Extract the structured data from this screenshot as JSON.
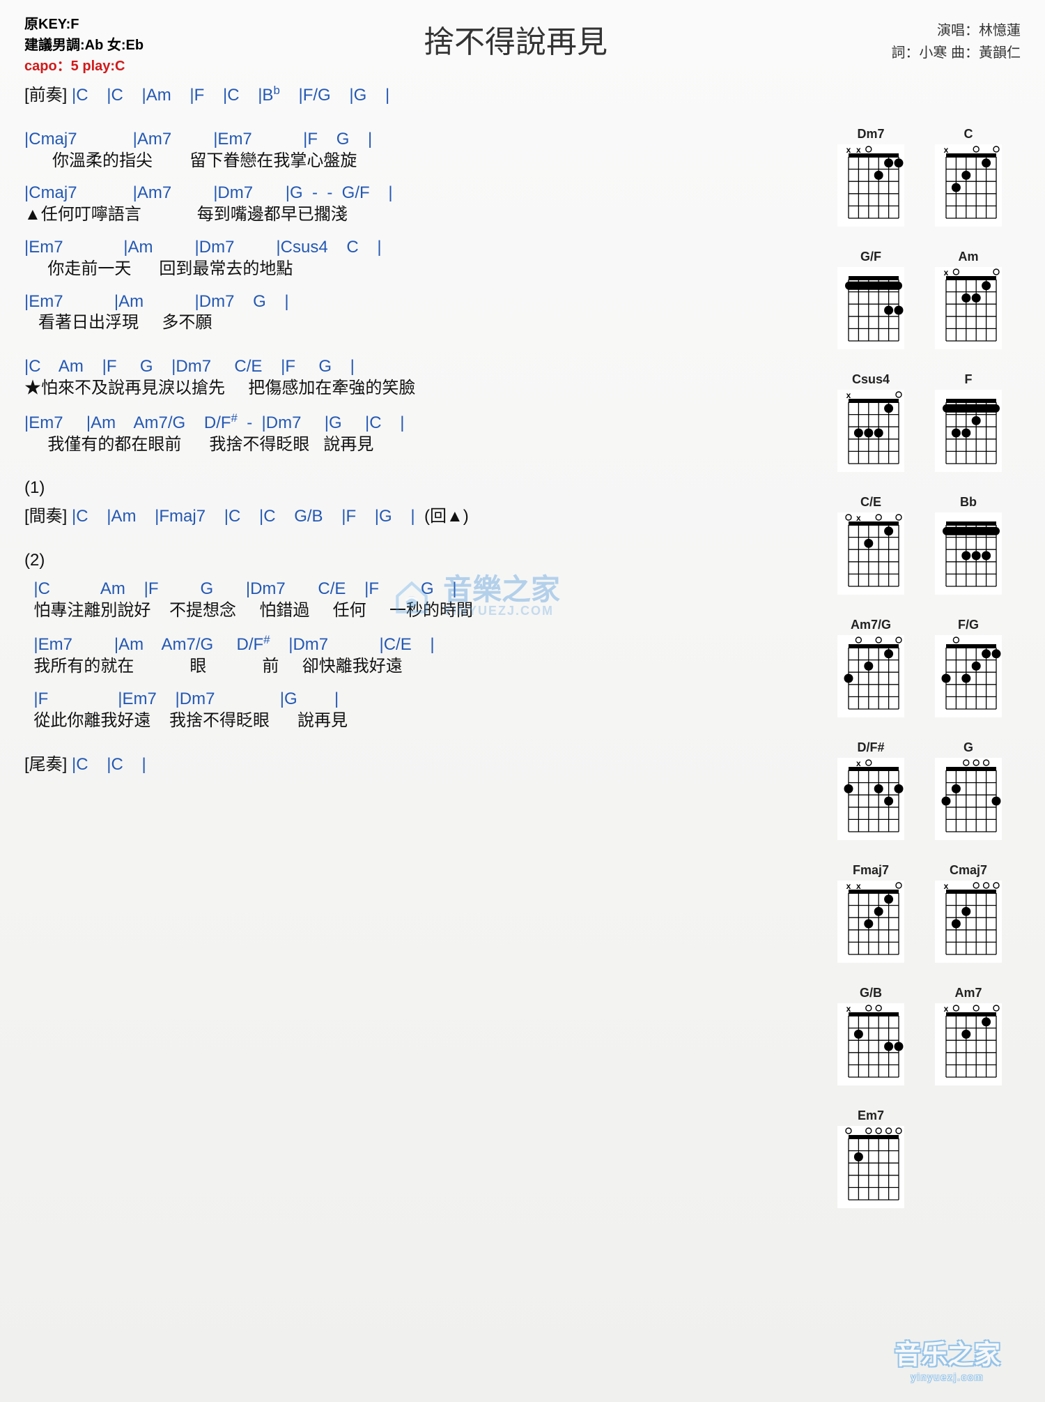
{
  "header": {
    "title": "捨不得說再見",
    "original_key": "原KEY:F",
    "suggest_key": "建議男調:Ab 女:Eb",
    "capo": "capo：5 play:C",
    "credit_top": "演唱：林憶蓮",
    "credit_bottom": "詞：小寒  曲：黃韻仁"
  },
  "sections": {
    "intro_label": "[前奏]",
    "intro_chords": " |C    |C    |Am    |F    |C    |B",
    "intro_chords2": "    |F/G    |G    |",
    "interlude_label": "[間奏]",
    "outro_label": "[尾奏]",
    "num1": "(1)",
    "num2": "(2)",
    "repeat": "(回▲)"
  },
  "verse1": {
    "c1": "|Cmaj7            |Am7         |Em7           |F    G    |",
    "l1": "      你溫柔的指尖        留下眷戀在我掌心盤旋",
    "c2": "|Cmaj7            |Am7         |Dm7       |G  -  -  G/F    |",
    "l2": "▲任何叮嚀語言            每到嘴邊都早已擱淺",
    "c3": "|Em7             |Am         |Dm7         |Csus4    C    |",
    "l3": "     你走前一天      回到最常去的地點",
    "c4": "|Em7           |Am           |Dm7    G    |",
    "l4": "   看著日出浮現     多不願"
  },
  "chorus": {
    "c1": "|C    Am    |F     G    |Dm7     C/E    |F     G    |",
    "l1": "★怕來不及說再見淚以搶先     把傷感加在牽強的笑臉",
    "c2": "|Em7     |Am    Am7/G    D/F",
    "c2b": "  -  |Dm7     |G     |C    |",
    "l2": "     我僅有的都在眼前      我捨不得眨眼   說再見"
  },
  "interlude": {
    "c": " |C    |Am    |Fmaj7    |C    |C    G/B    |F    |G    |  "
  },
  "verse2": {
    "c1": "  |C           Am    |F         G       |Dm7       C/E    |F         G    |",
    "l1": "  怕專注離別說好    不提想念     怕錯過     任何     一秒的時間",
    "c2": "  |Em7         |Am    Am7/G     D/F",
    "c2b": "    |Dm7           |C/E    |",
    "l2": "  我所有的就在            眼            前     卻快離我好遠",
    "c3": "  |F               |Em7    |Dm7              |G        |",
    "l3": "  從此你離我好遠    我捨不得眨眼      說再見"
  },
  "outro": {
    "c": " |C    |C    |"
  },
  "diagrams": {
    "rows": [
      [
        {
          "name": "Dm7",
          "nut": true,
          "barre": null,
          "dots": [
            [
              1,
              1
            ],
            [
              2,
              1
            ],
            [
              3,
              2
            ]
          ],
          "open": [
            4
          ],
          "mute": [
            5,
            6
          ]
        },
        {
          "name": "C",
          "nut": true,
          "barre": null,
          "dots": [
            [
              2,
              1
            ],
            [
              4,
              2
            ],
            [
              5,
              3
            ]
          ],
          "open": [
            1,
            3
          ],
          "mute": [
            6
          ]
        }
      ],
      [
        {
          "name": "G/F",
          "nut": true,
          "barre": [
            1,
            1,
            6
          ],
          "dots": [
            [
              1,
              3
            ],
            [
              2,
              3
            ]
          ],
          "open": [],
          "mute": []
        },
        {
          "name": "Am",
          "nut": true,
          "barre": null,
          "dots": [
            [
              2,
              1
            ],
            [
              3,
              2
            ],
            [
              4,
              2
            ]
          ],
          "open": [
            1,
            5
          ],
          "mute": [
            6
          ]
        }
      ],
      [
        {
          "name": "Csus4",
          "nut": true,
          "barre": null,
          "dots": [
            [
              2,
              1
            ],
            [
              4,
              3
            ],
            [
              5,
              3
            ],
            [
              3,
              3
            ]
          ],
          "open": [
            1
          ],
          "mute": [
            6
          ]
        },
        {
          "name": "F",
          "nut": true,
          "barre": [
            1,
            1,
            6
          ],
          "dots": [
            [
              3,
              2
            ],
            [
              4,
              3
            ],
            [
              5,
              3
            ]
          ],
          "open": [],
          "mute": []
        }
      ],
      [
        {
          "name": "C/E",
          "nut": true,
          "barre": null,
          "dots": [
            [
              2,
              1
            ],
            [
              4,
              2
            ]
          ],
          "open": [
            1,
            3,
            6
          ],
          "mute": [
            5
          ]
        },
        {
          "name": "Bb",
          "nut": true,
          "barre": [
            1,
            1,
            6
          ],
          "dots": [
            [
              2,
              3
            ],
            [
              3,
              3
            ],
            [
              4,
              3
            ]
          ],
          "open": [],
          "mute": []
        }
      ],
      [
        {
          "name": "Am7/G",
          "nut": true,
          "barre": null,
          "dots": [
            [
              2,
              1
            ],
            [
              4,
              2
            ],
            [
              6,
              3
            ]
          ],
          "open": [
            1,
            3,
            5
          ],
          "mute": []
        },
        {
          "name": "F/G",
          "nut": true,
          "barre": null,
          "dots": [
            [
              1,
              1
            ],
            [
              2,
              1
            ],
            [
              3,
              2
            ],
            [
              4,
              3
            ],
            [
              6,
              3
            ]
          ],
          "open": [
            5
          ],
          "mute": []
        }
      ],
      [
        {
          "name": "D/F#",
          "nut": true,
          "barre": null,
          "dots": [
            [
              1,
              2
            ],
            [
              3,
              2
            ],
            [
              6,
              2
            ],
            [
              2,
              3
            ]
          ],
          "open": [
            4
          ],
          "mute": [
            5
          ]
        },
        {
          "name": "G",
          "nut": true,
          "barre": null,
          "dots": [
            [
              5,
              2
            ],
            [
              6,
              3
            ],
            [
              1,
              3
            ]
          ],
          "open": [
            2,
            3,
            4
          ],
          "mute": []
        }
      ],
      [
        {
          "name": "Fmaj7",
          "nut": true,
          "barre": null,
          "dots": [
            [
              2,
              1
            ],
            [
              3,
              2
            ],
            [
              4,
              3
            ]
          ],
          "open": [
            1
          ],
          "mute": [
            5,
            6
          ]
        },
        {
          "name": "Cmaj7",
          "nut": true,
          "barre": null,
          "dots": [
            [
              4,
              2
            ],
            [
              5,
              3
            ]
          ],
          "open": [
            1,
            2,
            3
          ],
          "mute": [
            6
          ]
        }
      ],
      [
        {
          "name": "G/B",
          "nut": true,
          "barre": null,
          "dots": [
            [
              5,
              2
            ],
            [
              1,
              3
            ],
            [
              2,
              3
            ]
          ],
          "open": [
            3,
            4
          ],
          "mute": [
            6
          ]
        },
        {
          "name": "Am7",
          "nut": true,
          "barre": null,
          "dots": [
            [
              2,
              1
            ],
            [
              4,
              2
            ]
          ],
          "open": [
            1,
            3,
            5
          ],
          "mute": [
            6
          ]
        }
      ],
      [
        {
          "name": "Em7",
          "nut": true,
          "barre": null,
          "dots": [
            [
              5,
              2
            ]
          ],
          "open": [
            1,
            2,
            3,
            4,
            6
          ],
          "mute": []
        }
      ]
    ]
  },
  "watermark": {
    "text": "音樂之家",
    "url": "YINYUEZJ.COM"
  },
  "bottom": {
    "text": "音乐之家",
    "url": "yinyuezj.com"
  }
}
